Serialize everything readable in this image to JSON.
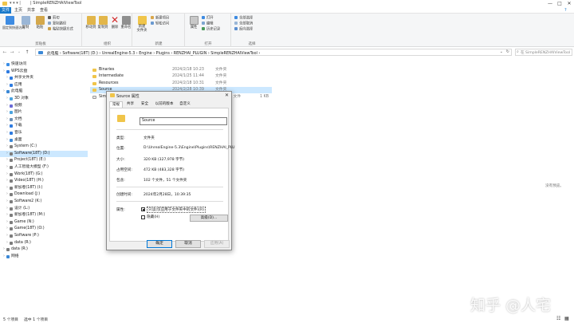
{
  "window": {
    "title": "| SimpleRENZHAIViewTool",
    "controls": [
      "—",
      "□",
      "✕"
    ]
  },
  "ribbon_tabs": [
    "文件",
    "主页",
    "共享",
    "查看"
  ],
  "ribbon": {
    "clipboard": {
      "group_label": "剪贴板",
      "pin": "固定到快速访问",
      "copy": "复制",
      "paste": "粘贴",
      "cut": "剪切",
      "copy_path": "复制路径",
      "paste_shortcut": "粘贴快捷方式"
    },
    "organize": {
      "group_label": "组织",
      "move_to": "移动到",
      "copy_to": "复制到",
      "delete": "删除",
      "rename": "重命名"
    },
    "new": {
      "group_label": "新建",
      "new_folder": "新建\n文件夹",
      "new_item": "新建项目",
      "easy_access": "轻松访问"
    },
    "open": {
      "group_label": "打开",
      "properties": "属性",
      "open": "打开",
      "edit": "编辑",
      "history": "历史记录"
    },
    "select": {
      "group_label": "选择",
      "select_all": "全部选择",
      "select_none": "全部取消",
      "invert": "反向选择"
    }
  },
  "address": {
    "crumbs": "此电脑  ›  Software(18T) (D:)  ›  UnrealEngine-5.3  ›  Engine  ›  Plugins  ›  RENZHAI_PLUGIN  ›  SimpleRENZHAIViewTool  ›",
    "search_placeholder": "在 SimpleRENZHAIViewTool"
  },
  "nav": {
    "items": [
      {
        "label": "快速访问",
        "indent": 0,
        "color": "#3c8ee6"
      },
      {
        "label": "WPS云盘",
        "indent": 0,
        "color": "#2e7be0"
      },
      {
        "label": "共享文件夹",
        "indent": 1,
        "color": "#2e7be0"
      },
      {
        "label": "应用",
        "indent": 1,
        "color": "#2e7be0"
      },
      {
        "label": "此电脑",
        "indent": 0,
        "color": "#3b88d6"
      },
      {
        "label": "3D 对象",
        "indent": 1,
        "color": "#4aa3e0"
      },
      {
        "label": "视频",
        "indent": 1,
        "color": "#6a6ad6"
      },
      {
        "label": "图片",
        "indent": 1,
        "color": "#4aa3e0"
      },
      {
        "label": "文档",
        "indent": 1,
        "color": "#6b8fb5"
      },
      {
        "label": "下载",
        "indent": 1,
        "color": "#2e7be0"
      },
      {
        "label": "音乐",
        "indent": 1,
        "color": "#2e7be0"
      },
      {
        "label": "桌面",
        "indent": 1,
        "color": "#3b88d6"
      },
      {
        "label": "System (C:)",
        "indent": 1,
        "color": "#7d7d7d"
      },
      {
        "label": "Software(18T) (D:)",
        "indent": 1,
        "color": "#7d7d7d",
        "selected": true
      },
      {
        "label": "Project(18T) (E:)",
        "indent": 1,
        "color": "#7d7d7d"
      },
      {
        "label": "人工智能大模型 (F:)",
        "indent": 1,
        "color": "#7d7d7d"
      },
      {
        "label": "Work(18T) (G:)",
        "indent": 1,
        "color": "#7d7d7d"
      },
      {
        "label": "Video(18T) (H:)",
        "indent": 1,
        "color": "#7d7d7d"
      },
      {
        "label": "新加卷(18T) (I:)",
        "indent": 1,
        "color": "#7d7d7d"
      },
      {
        "label": "Download (J:)",
        "indent": 1,
        "color": "#7d7d7d"
      },
      {
        "label": "Software2 (K:)",
        "indent": 1,
        "color": "#7d7d7d"
      },
      {
        "label": "设计 (L:)",
        "indent": 1,
        "color": "#7d7d7d"
      },
      {
        "label": "新加卷(18T) (M:)",
        "indent": 1,
        "color": "#7d7d7d"
      },
      {
        "label": "Game (N:)",
        "indent": 1,
        "color": "#7d7d7d"
      },
      {
        "label": "Game(18T) (O:)",
        "indent": 1,
        "color": "#7d7d7d"
      },
      {
        "label": "Software (P:)",
        "indent": 1,
        "color": "#7d7d7d"
      },
      {
        "label": "data (R:)",
        "indent": 1,
        "color": "#7d7d7d"
      },
      {
        "label": "data (R:)",
        "indent": 0,
        "color": "#7d7d7d"
      },
      {
        "label": "网络",
        "indent": 0,
        "color": "#3b88d6"
      }
    ]
  },
  "files": [
    {
      "name": "Binaries",
      "date": "2024/2/18 10:23",
      "type": "文件夹",
      "size": ""
    },
    {
      "name": "Intermediate",
      "date": "2024/1/25 11:44",
      "type": "文件夹",
      "size": ""
    },
    {
      "name": "Resources",
      "date": "2024/2/18 10:31",
      "type": "文件夹",
      "size": ""
    },
    {
      "name": "Source",
      "date": "2024/2/28 10:39",
      "type": "文件夹",
      "size": "",
      "selected": true
    },
    {
      "name": "SimpleRENZHAIViewTool.uplugin",
      "date": "2024/1/25 11:44",
      "type": "UPLUGIN 文件",
      "size": "1 KB"
    }
  ],
  "empty_right_msg": "没有预览。",
  "status": {
    "count": "5 个项目",
    "selected": "选中 1 个项目"
  },
  "dialog": {
    "title": "Source 属性",
    "tabs": [
      "常规",
      "共享",
      "安全",
      "以前的版本",
      "自定义"
    ],
    "name": "Source",
    "rows": [
      {
        "label": "类型:",
        "value": "文件夹"
      },
      {
        "label": "位置:",
        "value": "D:\\UnrealEngine-5.3\\Engine\\Plugins\\RENZHAI_PLU"
      },
      {
        "label": "大小:",
        "value": "320 KB (327,978 字节)"
      },
      {
        "label": "占用空间:",
        "value": "472 KB (483,328 字节)"
      },
      {
        "label": "包含:",
        "value": "102 个文件，51 个文件夹"
      },
      {
        "label": "创建时间:",
        "value": "2024年2月28日，10:39:35"
      }
    ],
    "attributes_label": "属性:",
    "readonly_label": "只读(仅应用于文件夹中的文件)(R)",
    "hidden_label": "隐藏(H)",
    "advanced_btn": "高级(D)...",
    "ok": "确定",
    "cancel": "取消",
    "apply": "应用(A)"
  },
  "watermark": "知乎 @人宅"
}
